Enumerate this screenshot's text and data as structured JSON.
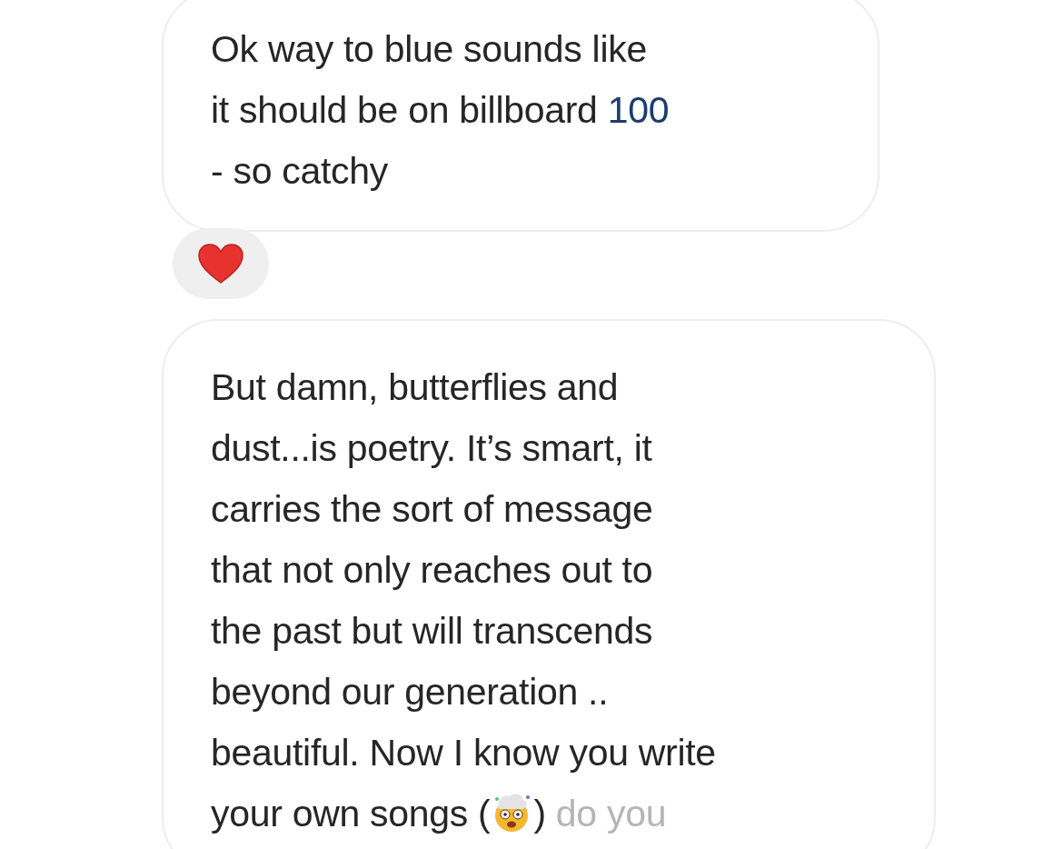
{
  "messages": [
    {
      "lines": [
        [
          {
            "kind": "text",
            "text": "Ok way to blue sounds like"
          }
        ],
        [
          {
            "kind": "text",
            "text": "it should be on billboard "
          },
          {
            "kind": "link",
            "text": "100"
          }
        ],
        [
          {
            "kind": "text",
            "text": "- so catchy"
          }
        ]
      ],
      "reaction": {
        "kind": "heart"
      }
    },
    {
      "lines": [
        [
          {
            "kind": "text",
            "text": "But damn, butterflies and"
          }
        ],
        [
          {
            "kind": "text",
            "text": "dust...is poetry. It’s smart, it"
          }
        ],
        [
          {
            "kind": "text",
            "text": "carries the sort of message"
          }
        ],
        [
          {
            "kind": "text",
            "text": "that not only reaches out to"
          }
        ],
        [
          {
            "kind": "text",
            "text": "the past but will  transcends"
          }
        ],
        [
          {
            "kind": "text",
            "text": "beyond our generation .."
          }
        ],
        [
          {
            "kind": "text",
            "text": "beautiful. Now I know you write"
          }
        ],
        [
          {
            "kind": "text",
            "text": "your own songs ("
          },
          {
            "kind": "emoji"
          },
          {
            "kind": "text",
            "text": ")"
          },
          {
            "kind": "faded",
            "text": " do you"
          }
        ]
      ]
    }
  ]
}
